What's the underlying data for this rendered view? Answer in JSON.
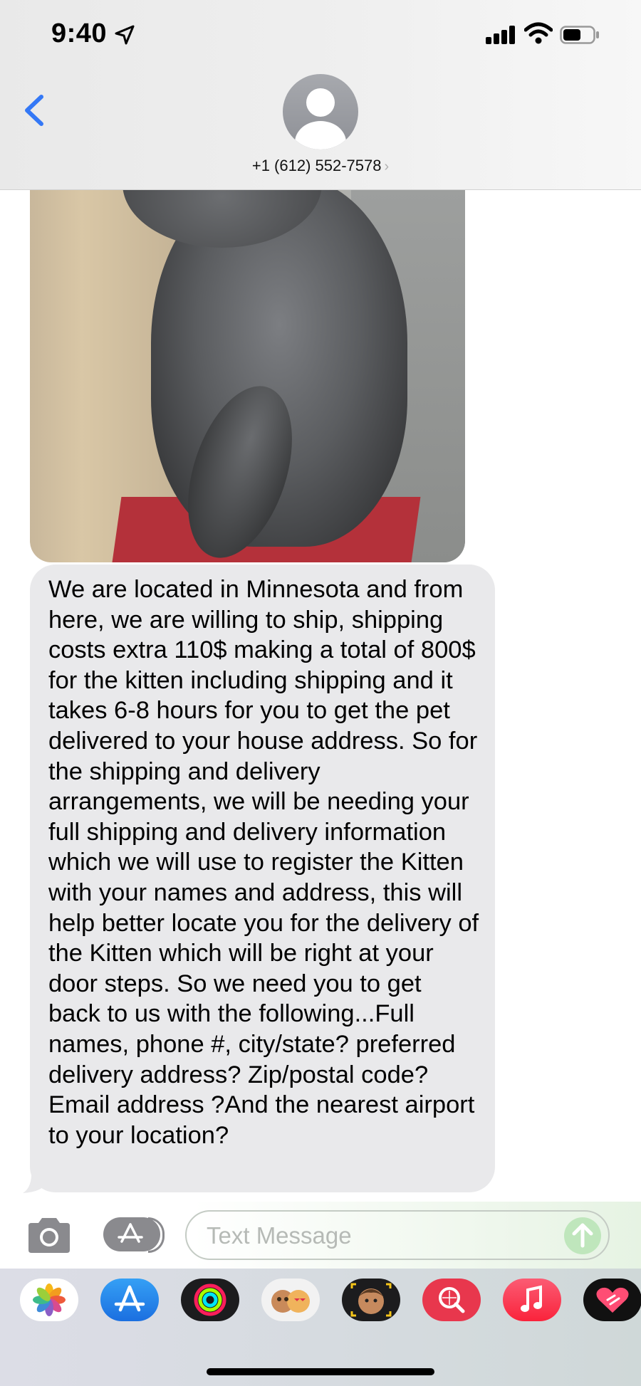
{
  "status_bar": {
    "time": "9:40"
  },
  "header": {
    "contact": "+1 (612) 552-7578",
    "chevron": "›"
  },
  "conversation": {
    "image_alt": "gray kitten sitting on a red cushion",
    "message_text": "We are located in Minnesota and from here, we are willing to ship, shipping costs extra 110$ making a total of 800$ for the kitten including shipping and it takes 6-8 hours for you to get the pet delivered to your house address. So for the shipping and delivery arrangements, we will be needing your full shipping and delivery information which we will use to register the Kitten with your names and address, this will help better locate you for the delivery of the Kitten which will be right at your door steps. So we need you to get back to us with the following...Full names, phone #, city/state? preferred delivery address? Zip/postal code? Email address ?And the nearest airport to your location?"
  },
  "compose": {
    "placeholder": "Text Message",
    "value": ""
  },
  "app_drawer": {
    "apps": [
      "photos-icon",
      "app-store-icon",
      "activity-icon",
      "stickers-icon",
      "memoji-icon",
      "image-search-icon",
      "music-icon",
      "digital-touch-icon"
    ]
  },
  "colors": {
    "accent_blue": "#3478f6",
    "bubble_gray": "#e9e9eb",
    "send_green": "#bfe6bc"
  }
}
